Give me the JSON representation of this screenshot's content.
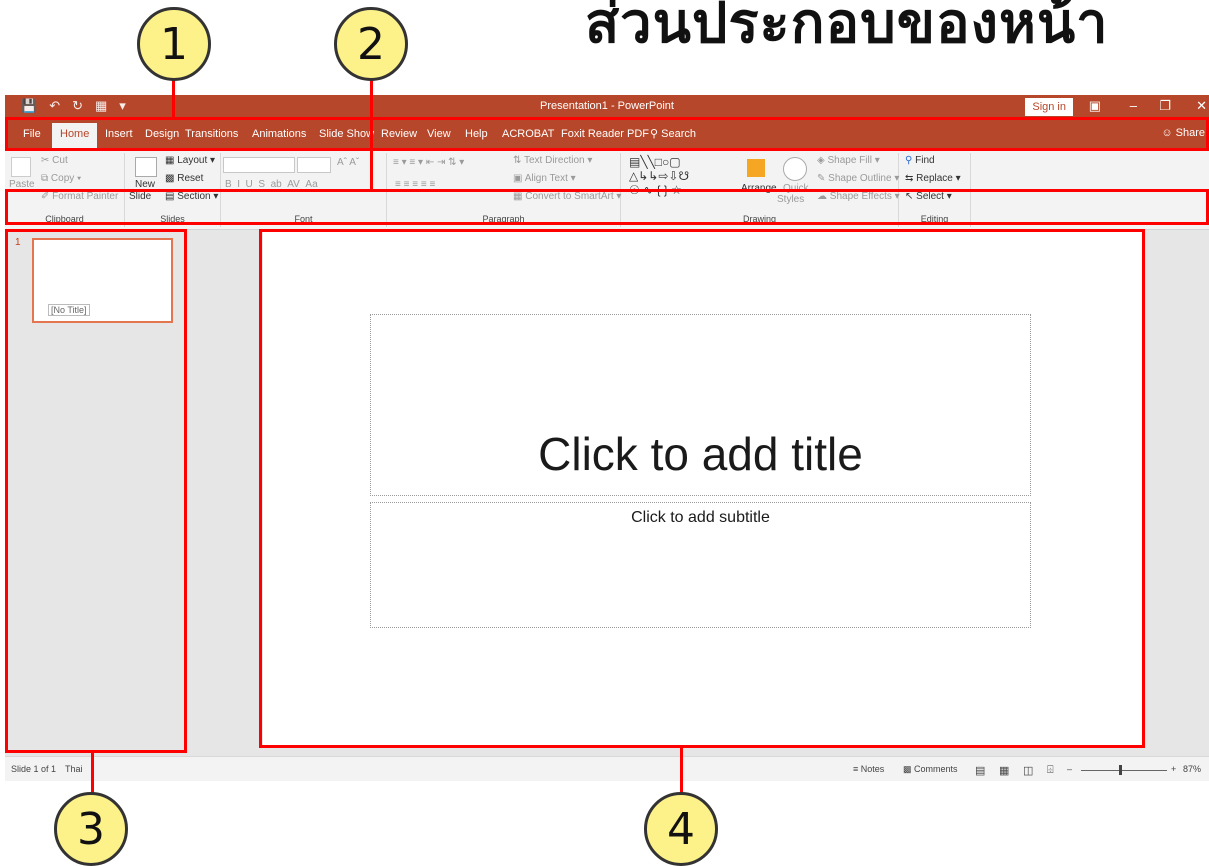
{
  "heading": "ส่วนประกอบของหน้า",
  "callouts": [
    "1",
    "2",
    "3",
    "4"
  ],
  "window": {
    "title": "Presentation1  -  PowerPoint",
    "signin": "Sign in",
    "tabs": [
      "File",
      "Home",
      "Insert",
      "Design",
      "Transitions",
      "Animations",
      "Slide Show",
      "Review",
      "View",
      "Help",
      "ACROBAT",
      "Foxit Reader PDF"
    ],
    "tellme": "Search",
    "share": "Share"
  },
  "ribbon": {
    "clipboard": {
      "label": "Clipboard",
      "paste": "Paste",
      "cut": "Cut",
      "copy": "Copy",
      "format_painter": "Format Painter"
    },
    "slides": {
      "label": "Slides",
      "new_slide_1": "New",
      "new_slide_2": "Slide",
      "layout": "Layout",
      "reset": "Reset",
      "section": "Section"
    },
    "font": {
      "label": "Font"
    },
    "paragraph": {
      "label": "Paragraph",
      "text_direction": "Text Direction",
      "align_text": "Align Text",
      "smartart": "Convert to SmartArt"
    },
    "drawing": {
      "label": "Drawing",
      "arrange": "Arrange",
      "quick": "Quick",
      "styles": "Styles",
      "shape_fill": "Shape Fill",
      "shape_outline": "Shape Outline",
      "shape_effects": "Shape Effects"
    },
    "editing": {
      "label": "Editing",
      "find": "Find",
      "replace": "Replace",
      "select": "Select"
    }
  },
  "slides_pane": {
    "number": "1",
    "thumb_label": "[No Title]"
  },
  "slide": {
    "title_placeholder": "Click to add title",
    "subtitle_placeholder": "Click to add subtitle"
  },
  "status": {
    "slide_count": "Slide 1 of 1",
    "language": "Thai",
    "notes": "Notes",
    "comments": "Comments",
    "zoom": "87%"
  },
  "colors": {
    "accent": "#b7472a",
    "highlight": "#ff0000",
    "callout_fill": "#fdf28a"
  }
}
